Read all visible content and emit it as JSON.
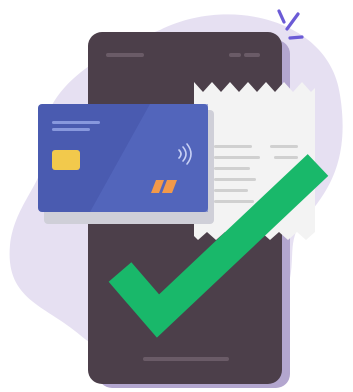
{
  "illustration": {
    "subject": "payment-approved",
    "icons": [
      "phone-icon",
      "credit-card-icon",
      "receipt-icon",
      "checkmark-icon",
      "sparkle-icon"
    ]
  },
  "colors": {
    "background": "#ffffff",
    "blob": "#e6e0f2",
    "phone_body": "#4c3f4a",
    "phone_side": "#b3a6cf",
    "phone_detail": "#6a5b67",
    "receipt": "#f3f3f3",
    "receipt_lines": "#d0d0d0",
    "card": "#4a5bb0",
    "card_highlight": "#5a6dc4",
    "card_chip": "#f2c94c",
    "card_logo": "#f2994a",
    "checkmark": "#19b86a",
    "sparkle": "#6b5bd6"
  }
}
